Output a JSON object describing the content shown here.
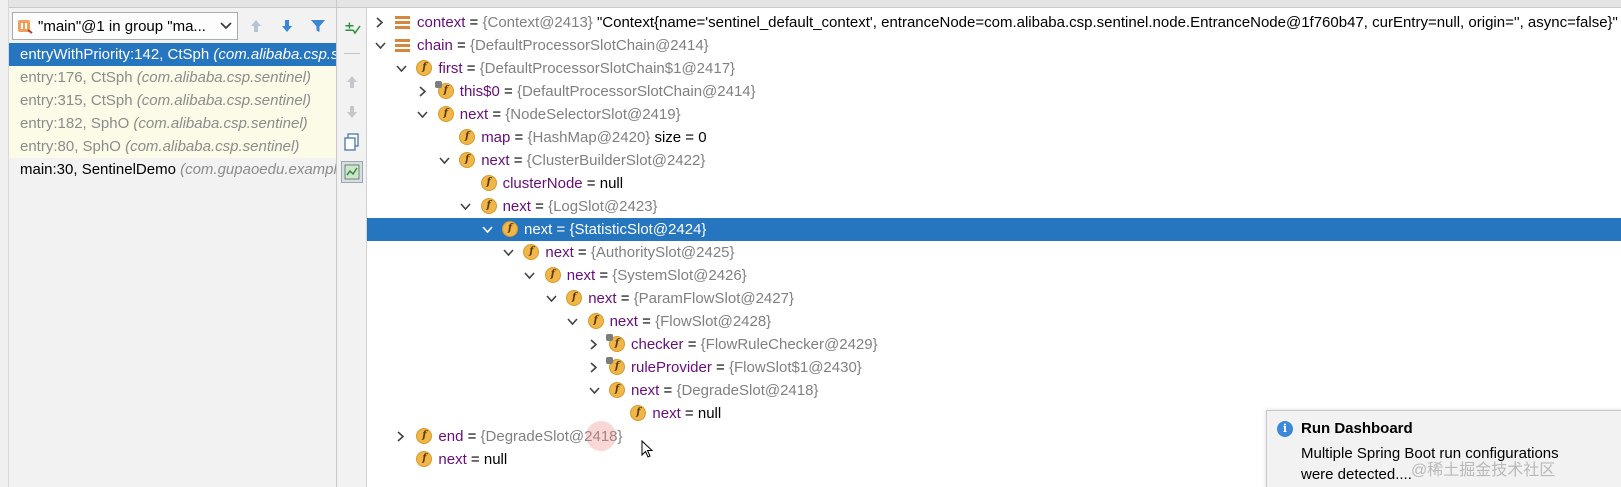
{
  "frames": {
    "thread_selector": "\"main\"@1 in group \"ma...",
    "items": [
      {
        "method": "entryWithPriority:142, CtSph",
        "package": "(com.alibaba.csp.sentinel)",
        "state": "selected"
      },
      {
        "method": "entry:176, CtSph",
        "package": "(com.alibaba.csp.sentinel)",
        "state": "library"
      },
      {
        "method": "entry:315, CtSph",
        "package": "(com.alibaba.csp.sentinel)",
        "state": "library"
      },
      {
        "method": "entry:182, SphO",
        "package": "(com.alibaba.csp.sentinel)",
        "state": "library"
      },
      {
        "method": "entry:80, SphO",
        "package": "(com.alibaba.csp.sentinel)",
        "state": "library"
      },
      {
        "method": "main:30, SentinelDemo",
        "package": "(com.gupaoedu.example)",
        "state": "plain"
      }
    ]
  },
  "variables": {
    "rows": [
      {
        "name": "context",
        "type": "{Context@2413}",
        "value": "\"Context{name='sentinel_default_context', entranceNode=com.alibaba.csp.sentinel.node.EntranceNode@1f760b47, curEntry=null, origin='', async=false}\"",
        "icon": "list",
        "chevron": "right"
      },
      {
        "name": "chain",
        "type": "{DefaultProcessorSlotChain@2414}",
        "value": "",
        "icon": "list",
        "chevron": "down"
      },
      {
        "name": "first",
        "type": "{DefaultProcessorSlotChain$1@2417}",
        "value": "",
        "icon": "field",
        "chevron": "down"
      },
      {
        "name": "this$0",
        "type": "{DefaultProcessorSlotChain@2414}",
        "value": "",
        "icon": "field-final",
        "chevron": "right"
      },
      {
        "name": "next",
        "type": "{NodeSelectorSlot@2419}",
        "value": "",
        "icon": "field",
        "chevron": "down"
      },
      {
        "name": "map",
        "type": "{HashMap@2420}",
        "value": " size = 0",
        "icon": "field",
        "chevron": "none"
      },
      {
        "name": "next",
        "type": "{ClusterBuilderSlot@2422}",
        "value": "",
        "icon": "field",
        "chevron": "down"
      },
      {
        "name": "clusterNode",
        "type": "",
        "value": "null",
        "icon": "field",
        "chevron": "none"
      },
      {
        "name": "next",
        "type": "{LogSlot@2423}",
        "value": "",
        "icon": "field",
        "chevron": "down"
      },
      {
        "name": "next",
        "type": "{StatisticSlot@2424}",
        "value": "",
        "icon": "field",
        "chevron": "down",
        "selected": true
      },
      {
        "name": "next",
        "type": "{AuthoritySlot@2425}",
        "value": "",
        "icon": "field",
        "chevron": "down"
      },
      {
        "name": "next",
        "type": "{SystemSlot@2426}",
        "value": "",
        "icon": "field",
        "chevron": "down"
      },
      {
        "name": "next",
        "type": "{ParamFlowSlot@2427}",
        "value": "",
        "icon": "field",
        "chevron": "down"
      },
      {
        "name": "next",
        "type": "{FlowSlot@2428}",
        "value": "",
        "icon": "field",
        "chevron": "down"
      },
      {
        "name": "checker",
        "type": "{FlowRuleChecker@2429}",
        "value": "",
        "icon": "field-final",
        "chevron": "right"
      },
      {
        "name": "ruleProvider",
        "type": "{FlowSlot$1@2430}",
        "value": "",
        "icon": "field-final",
        "chevron": "right"
      },
      {
        "name": "next",
        "type": "{DegradeSlot@2418}",
        "value": "",
        "icon": "field",
        "chevron": "down"
      },
      {
        "name": "next",
        "type": "",
        "value": "null",
        "icon": "field",
        "chevron": "none"
      },
      {
        "name": "end",
        "type": "{DegradeSlot@2418}",
        "value": "",
        "icon": "field",
        "chevron": "right"
      },
      {
        "name": "next",
        "type": "",
        "value": "null",
        "icon": "field",
        "chevron": "none"
      }
    ]
  },
  "notification": {
    "title": "Run Dashboard",
    "body_line1": "Multiple Spring Boot run configurations",
    "body_line2": "were detected...."
  },
  "watermark": "@稀土掘金技术社区",
  "colors": {
    "selection": "#2675bf",
    "library_frame_bg": "#fbfbe7",
    "field_icon": "#f1b64a",
    "var_name": "#660e7a",
    "type_text": "#808080"
  }
}
